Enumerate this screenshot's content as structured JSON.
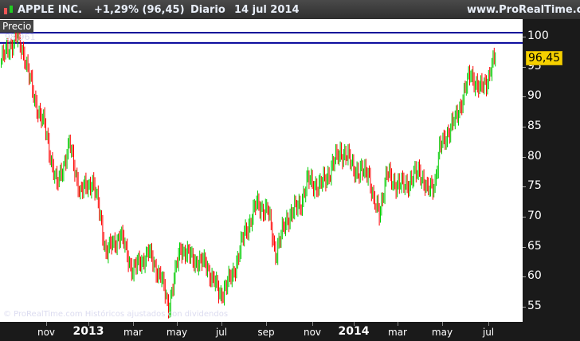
{
  "header": {
    "symbol": "APPLE INC.",
    "change": "+1,29% (96,45)",
    "period": "Diario",
    "date": "14 jul 2014",
    "site": "www.ProRealTime.com"
  },
  "panel": {
    "label": "Precio",
    "hline_label": "98,961",
    "watermark": "© ProRealTime.com  Históricos ajustados con dividendos"
  },
  "last_price": "96,45",
  "colors": {
    "up": "#00cc00",
    "down": "#ff0000",
    "hline": "#000099"
  },
  "chart_data": {
    "type": "candlestick",
    "title": "APPLE INC.",
    "ylim": [
      53,
      103
    ],
    "yticks": [
      "100",
      "95",
      "90",
      "85",
      "80",
      "75",
      "70",
      "65",
      "60",
      "55"
    ],
    "xticks": [
      "nov",
      "2013",
      "mar",
      "may",
      "jul",
      "sep",
      "nov",
      "2014",
      "mar",
      "may",
      "jul"
    ],
    "hlines": [
      100.66,
      98.96
    ],
    "total_bars": 465,
    "waypoints": [
      [
        0,
        96
      ],
      [
        13,
        100
      ],
      [
        21,
        97
      ],
      [
        29,
        90
      ],
      [
        39,
        85
      ],
      [
        50,
        75
      ],
      [
        61,
        82
      ],
      [
        71,
        74
      ],
      [
        82,
        76
      ],
      [
        89,
        70
      ],
      [
        94,
        64
      ],
      [
        107,
        67
      ],
      [
        118,
        61
      ],
      [
        132,
        64
      ],
      [
        143,
        60
      ],
      [
        150,
        55
      ],
      [
        161,
        65
      ],
      [
        171,
        63
      ],
      [
        184,
        62
      ],
      [
        196,
        57
      ],
      [
        207,
        60
      ],
      [
        218,
        67
      ],
      [
        229,
        72
      ],
      [
        239,
        71
      ],
      [
        246,
        64
      ],
      [
        257,
        70
      ],
      [
        268,
        72
      ],
      [
        275,
        76
      ],
      [
        286,
        75
      ],
      [
        296,
        78
      ],
      [
        304,
        81
      ],
      [
        314,
        79
      ],
      [
        321,
        77
      ],
      [
        329,
        78
      ],
      [
        334,
        72
      ],
      [
        339,
        71
      ],
      [
        346,
        77
      ],
      [
        357,
        75
      ],
      [
        368,
        76
      ],
      [
        375,
        78
      ],
      [
        382,
        74
      ],
      [
        389,
        76
      ],
      [
        393,
        81
      ],
      [
        400,
        84
      ],
      [
        407,
        86
      ],
      [
        414,
        90
      ],
      [
        421,
        94
      ],
      [
        429,
        91
      ],
      [
        436,
        93
      ],
      [
        443,
        96.5
      ]
    ]
  }
}
